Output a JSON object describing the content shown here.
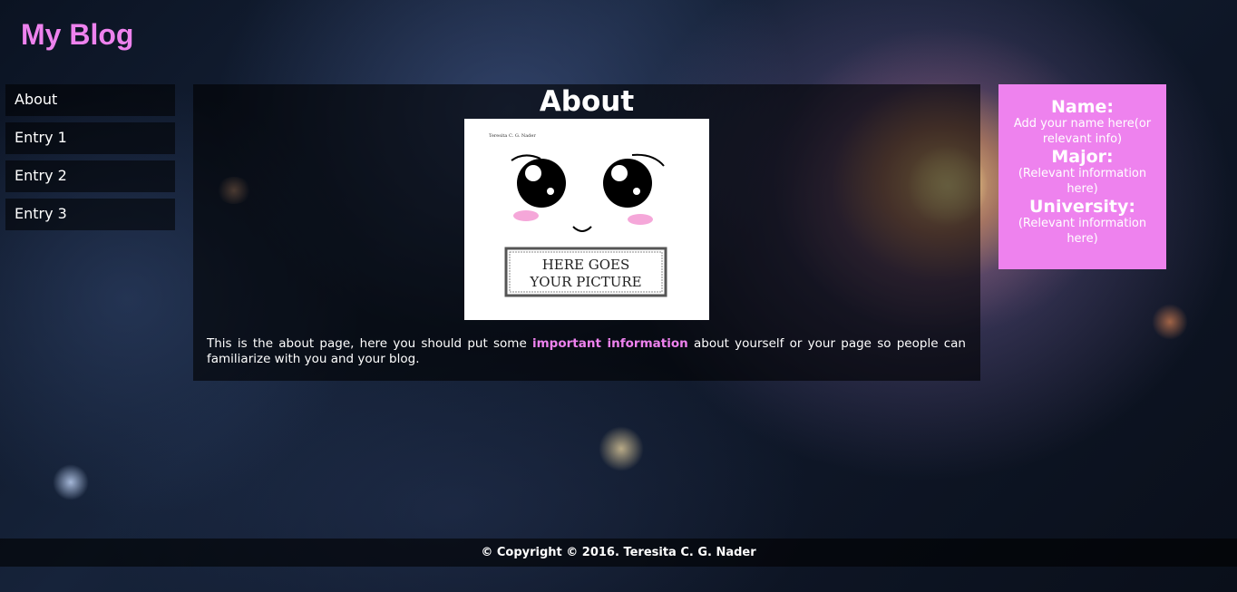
{
  "header": {
    "site_title": "My Blog"
  },
  "nav": {
    "items": [
      {
        "label": "About"
      },
      {
        "label": "Entry 1"
      },
      {
        "label": "Entry 2"
      },
      {
        "label": "Entry 3"
      }
    ]
  },
  "main": {
    "title": "About",
    "picture": {
      "caption_line1": "HERE GOES",
      "caption_line2": "YOUR PICTURE",
      "signature": "Teresita C. G. Nader"
    },
    "text_before": "This is the about page, here you should put some ",
    "text_highlight": "important information",
    "text_after": " about yourself or your page so people can familiarize with you and your blog."
  },
  "info": {
    "name_heading": "Name:",
    "name_value": "Add your name here(or relevant info)",
    "major_heading": "Major:",
    "major_value": "(Relevant information here)",
    "university_heading": "University:",
    "university_value": "(Relevant information here)"
  },
  "footer": {
    "copyright": "© Copyright © 2016. Teresita C. G. Nader"
  },
  "colors": {
    "accent": "#ee82ee",
    "panel": "rgba(0,0,0,0.6)",
    "text": "#ffffff"
  }
}
